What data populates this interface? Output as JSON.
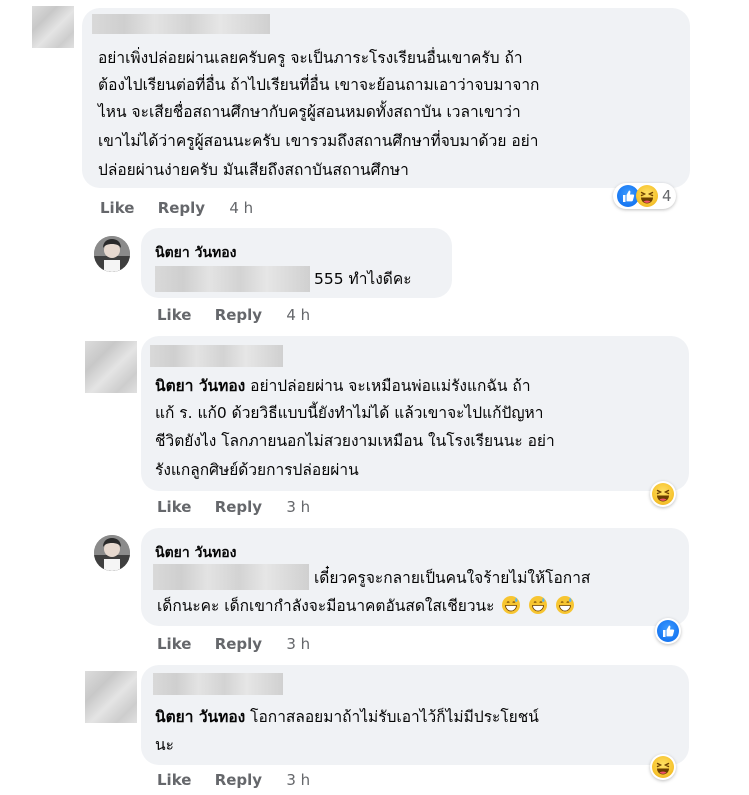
{
  "actions": {
    "like": "Like",
    "reply": "Reply"
  },
  "comments": [
    {
      "author": "",
      "lines": [
        "อย่าเพิ่งปล่อยผ่านเลยครับครู จะเป็นภาระโรงเรียนอื่นเขาครับ ถ้า",
        "ต้องไปเรียนต่อที่อื่น ถ้าไปเรียนที่อื่น เขาจะย้อนถามเอาว่าจบมาจาก",
        "ไหน จะเสียชื่อสถานศึกษากับครูผู้สอนหมดทั้งสถาบัน เวลาเขาว่า",
        "เขาไม่ได้ว่าครูผู้สอนนะครับ เขารวมถึงสถานศึกษาที่จบมาด้วย อย่า",
        "ปล่อยผ่านง่ายครับ มันเสียถึงสถาบันสถานศึกษา"
      ],
      "time": "4 h",
      "reactions": {
        "icons": [
          "like-reaction-icon",
          "haha-reaction-icon"
        ],
        "count": "4"
      }
    },
    {
      "author": "นิตยา วันทอง",
      "text": "555 ทำไงดีคะ",
      "time": "4 h"
    },
    {
      "author_inline": "นิตยา วันทอง",
      "lines": [
        " อย่าปล่อยผ่าน จะเหมือนพ่อแม่รังแกฉัน ถ้า",
        "แก้ ร. แก้0 ด้วยวิธีแบบนี้ยังทำไม่ได้ แล้วเขาจะไปแก้ปัญหา",
        "ชีวิตยังไง โลกภายนอกไม่สวยงามเหมือน ในโรงเรียนนะ อย่า",
        "รังแกลูกศิษย์ด้วยการปล่อยผ่าน"
      ],
      "time": "3 h",
      "reactions": {
        "icons": [
          "haha-reaction-icon"
        ]
      }
    },
    {
      "author": "นิตยา วันทอง",
      "lines": [
        "เดี๋ยวครูจะกลายเป็นคนใจร้ายไม่ให้โอกาส",
        "เด็กนะคะ เด็กเขากำลังจะมีอนาคตอันสดใสเชียวนะ"
      ],
      "time": "3 h",
      "reactions": {
        "icons": [
          "like-reaction-icon"
        ]
      }
    },
    {
      "author_inline": "นิตยา วันทอง",
      "lines": [
        " โอกาสลอยมาถ้าไม่รับเอาไว้ก็ไม่มีประโยชน์",
        "นะ"
      ],
      "time": "3 h",
      "reactions": {
        "icons": [
          "haha-reaction-icon"
        ]
      }
    }
  ],
  "colors": {
    "bubble": "#f0f2f5",
    "meta": "#65676b",
    "text": "#050505",
    "like_blue": "#1877f2",
    "haha_yellow": "#f7c531"
  }
}
